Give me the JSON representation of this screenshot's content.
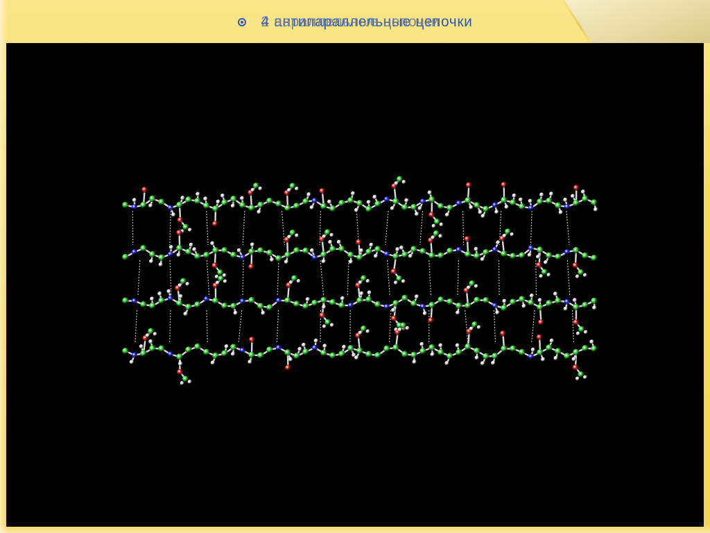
{
  "slide": {
    "title_lines": [
      "4 антипараллельные цепочки",
      "2 параллельные цепочки"
    ],
    "bullet_icon": "circle-bullet-icon",
    "colors": {
      "background": "#f5d85c",
      "title_primary": "#2f58b5",
      "title_secondary": "#6a7c9a",
      "image_background": "#000000"
    }
  },
  "figure": {
    "subject": "molecular-structure-image",
    "atom_colors": {
      "carbon": "#2ecc2e",
      "hydrogen": "#e8e8e8",
      "oxygen": "#d01818",
      "nitrogen": "#1a1ad8"
    },
    "chain_count": 4
  }
}
